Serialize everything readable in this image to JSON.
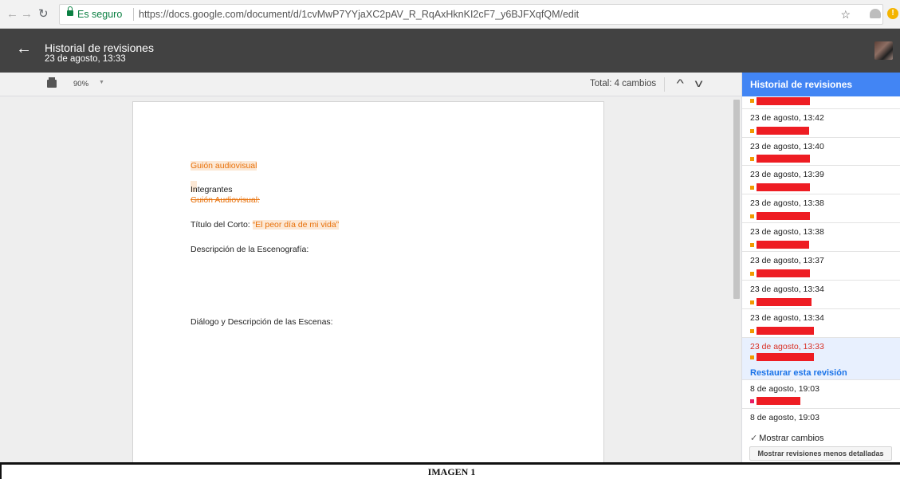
{
  "browser": {
    "secure_label": "Es seguro",
    "url": "https://docs.google.com/document/d/1cvMwP7YYjaXC2pAV_R_RqAxHknKI2cF7_y6BJFXqfQM/edit"
  },
  "header": {
    "title": "Historial de revisiones",
    "subtitle": "23 de agosto, 13:33"
  },
  "toolbar": {
    "zoom": "90%",
    "total_changes": "Total: 4 cambios"
  },
  "document": {
    "line1": "Guión audiovisual",
    "line2": "Integrantes",
    "line3_deleted": "Guión Audiovisual:",
    "title_label": "Título del Corto: ",
    "title_value": "“El peor día de mi vida”",
    "scenography": "Descripción de la Escenografía:",
    "dialogue": "Diálogo y Descripción de las Escenas:"
  },
  "panel": {
    "title": "Historial de revisiones",
    "revisions": [
      {
        "time": "",
        "dot_color": "#f29900"
      },
      {
        "time": "23 de agosto, 13:42",
        "dot_color": "#f29900"
      },
      {
        "time": "23 de agosto, 13:40",
        "dot_color": "#f29900"
      },
      {
        "time": "23 de agosto, 13:39",
        "dot_color": "#f29900"
      },
      {
        "time": "23 de agosto, 13:38",
        "dot_color": "#f29900"
      },
      {
        "time": "23 de agosto, 13:38",
        "dot_color": "#f29900"
      },
      {
        "time": "23 de agosto, 13:37",
        "dot_color": "#f29900"
      },
      {
        "time": "23 de agosto, 13:34",
        "dot_color": "#f29900"
      },
      {
        "time": "23 de agosto, 13:34",
        "dot_color": "#f29900"
      },
      {
        "time": "23 de agosto, 13:33",
        "dot_color": "#f29900",
        "selected": true
      },
      {
        "time": "8 de agosto, 19:03",
        "dot_color": "#e91e63"
      },
      {
        "time": "8 de agosto, 19:03",
        "dot_color": "#e91e63"
      }
    ],
    "restore_label": "Restaurar esta revisión",
    "show_changes_label": "Mostrar cambios",
    "less_detailed_label": "Mostrar revisiones menos detalladas"
  },
  "caption": "IMAGEN 1",
  "colors": {
    "accent": "#4285f4",
    "header_bg": "#424242",
    "redaction": "#ee1d23",
    "suggestion": "#e8710a"
  }
}
